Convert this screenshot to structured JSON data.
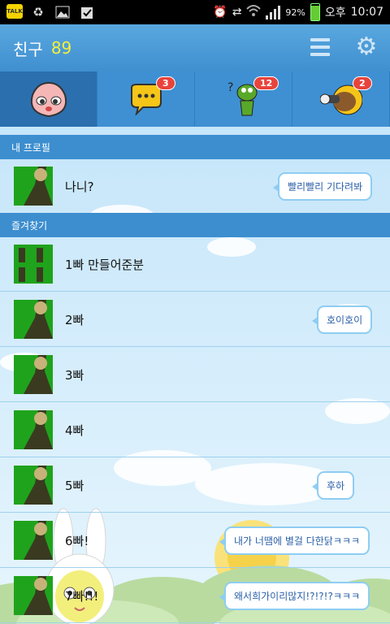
{
  "status_bar": {
    "talk_label": "TALK",
    "battery": "92%",
    "ampm": "오후",
    "time": "10:07",
    "icons": [
      "kakaotalk-notification-icon",
      "recycle-icon",
      "image-icon",
      "download-check-icon",
      "alarm-icon",
      "sync-icon",
      "wifi-icon",
      "signal-icon",
      "battery-icon"
    ]
  },
  "header": {
    "title": "친구",
    "count": "89"
  },
  "tabs": [
    {
      "name": "friends-tab",
      "badge": ""
    },
    {
      "name": "chats-tab",
      "badge": "3"
    },
    {
      "name": "find-tab",
      "badge": "12"
    },
    {
      "name": "more-tab",
      "badge": "2"
    }
  ],
  "sections": {
    "my_profile": "내 프로필",
    "favorites": "즐겨찾기"
  },
  "my_profile": {
    "name": "나니?",
    "status": "빨리빨리 기다려봐"
  },
  "favorites": [
    {
      "name": "1빠 만들어준분",
      "status": ""
    },
    {
      "name": "2빠",
      "status": "호이호이"
    },
    {
      "name": "3빠",
      "status": ""
    },
    {
      "name": "4빠",
      "status": ""
    },
    {
      "name": "5빠",
      "status": "후하"
    },
    {
      "name": "6빠!",
      "status": "내가 너땜에 별걸 다한닭ㅋㅋㅋ"
    },
    {
      "name": "7빠!!!",
      "status": "왜서희가이리많지!?!?!?ㅋㅋㅋ"
    }
  ],
  "colors": {
    "header": "#4a9ad8",
    "section": "#3c8ecf",
    "badge": "#e8443c",
    "count": "#f5ef3b",
    "bubble_border": "#8ecdf2"
  }
}
